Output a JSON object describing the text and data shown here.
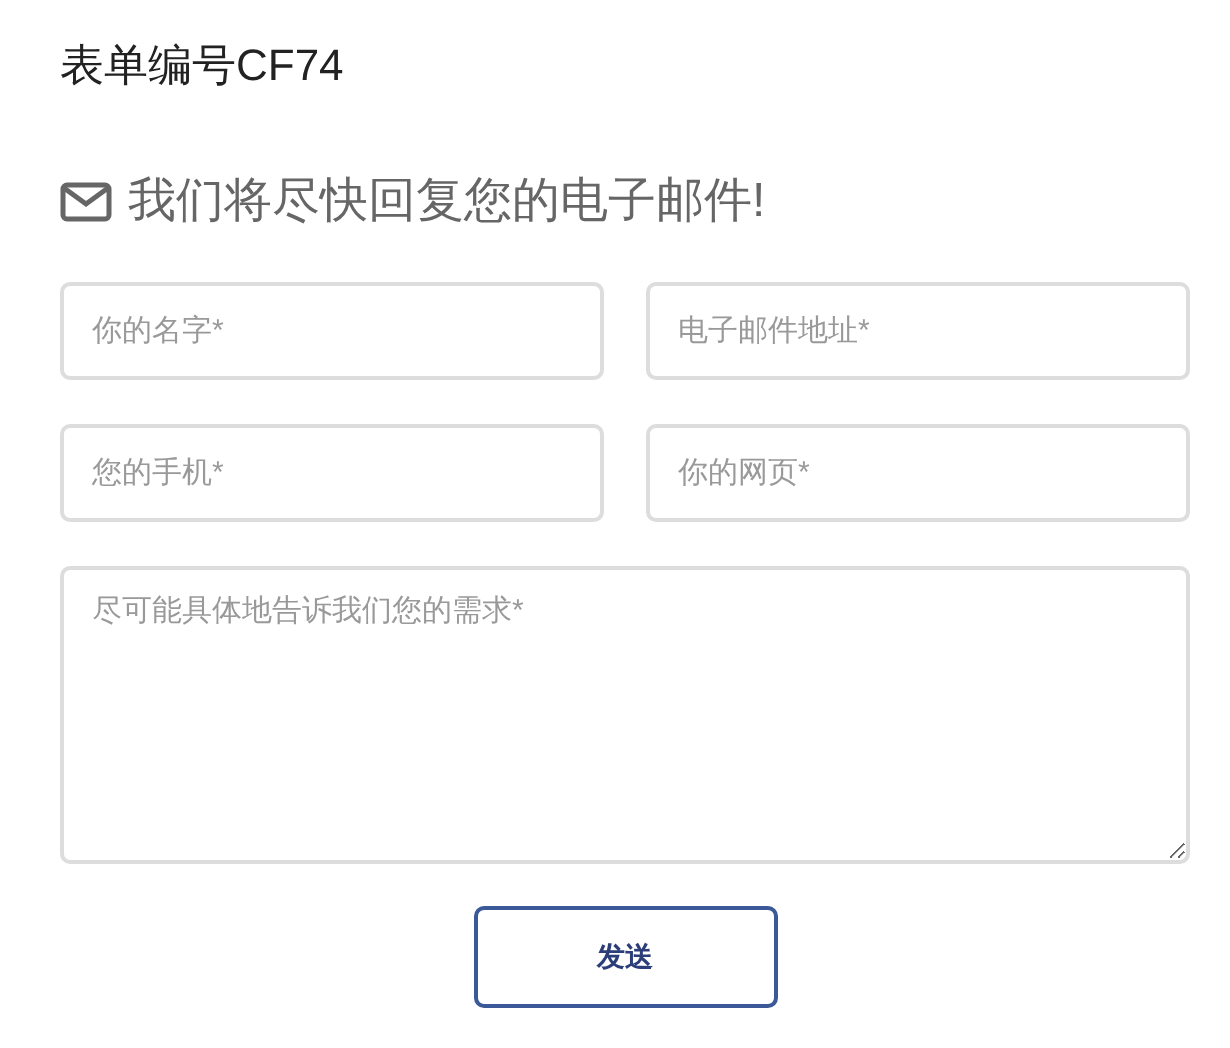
{
  "form_title": "表单编号CF74",
  "heading": "我们将尽快回复您的电子邮件!",
  "fields": [
    {
      "kind": "input",
      "placeholder": "你的名字*"
    },
    {
      "kind": "input",
      "placeholder": "电子邮件地址*"
    },
    {
      "kind": "input",
      "placeholder": "您的手机*"
    },
    {
      "kind": "input",
      "placeholder": "你的网页*"
    },
    {
      "kind": "textarea",
      "placeholder": "尽可能具体地告诉我们您的需求*"
    }
  ],
  "submit_button": "发送"
}
